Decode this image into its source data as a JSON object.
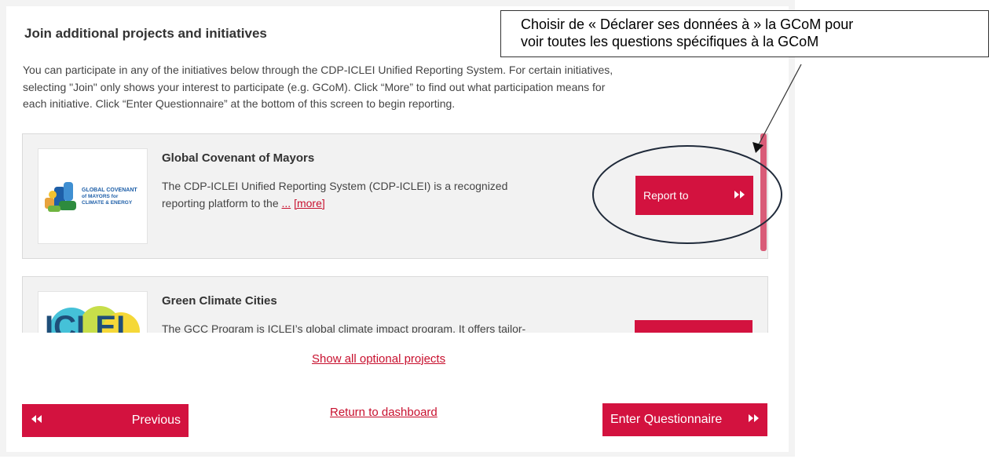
{
  "section": {
    "title": "Join additional projects and initiatives",
    "intro_lines": [
      "You can participate in any of the initiatives below through the CDP-ICLEI Unified Reporting System. For certain initiatives,",
      "selecting \"Join\" only shows your interest to participate (e.g. GCoM). Click “More” to find out what participation means for",
      "each initiative. Click “Enter Questionnaire” at the bottom of this screen to begin reporting."
    ]
  },
  "cards": [
    {
      "title": "Global Covenant of Mayors",
      "desc_line1": "The CDP-ICLEI Unified Reporting System (CDP-ICLEI) is a recognized",
      "desc_line2": "reporting platform to the ",
      "ellipsis": "...",
      "more_label": "[more]",
      "button_label": "Report to",
      "logo_text": [
        "GLOBAL COVENANT",
        "of MAYORS for",
        "CLIMATE & ENERGY"
      ]
    },
    {
      "title": "Green Climate Cities",
      "desc_line1": "The GCC Program is ICLEI’s global climate impact program. It offers tailor-",
      "logo_text": "ICLEI"
    }
  ],
  "links": {
    "show_all": "Show all optional projects",
    "return": "Return to dashboard"
  },
  "buttons": {
    "previous": "Previous",
    "enter": "Enter Questionnaire"
  },
  "callout": {
    "line1": "Choisir de « Déclarer ses données à » la GCoM pour",
    "line2": "voir toutes les questions spécifiques à la GCoM"
  },
  "colors": {
    "accent": "#d3123f",
    "link": "#c8102e",
    "card_bg": "#f2f2f2"
  },
  "icons": {
    "forward": "double-chevron-right-icon",
    "back": "double-chevron-left-icon"
  }
}
